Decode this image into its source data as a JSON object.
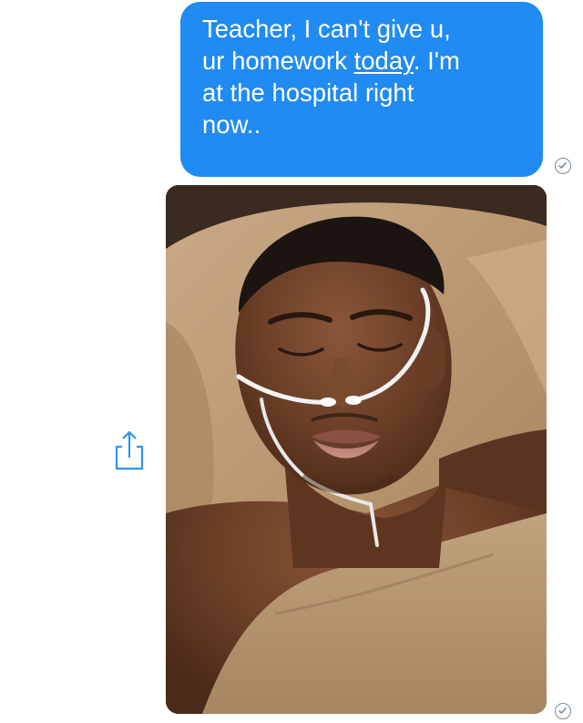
{
  "conversation": {
    "outgoing_message": {
      "lines": [
        {
          "before": "Teacher, I can't give u,",
          "link": "",
          "after": ""
        },
        {
          "before": "ur homework ",
          "link": "today",
          "after": ". I'm"
        },
        {
          "before": "at the hospital right",
          "link": "",
          "after": ""
        },
        {
          "before": "now..",
          "link": "",
          "after": ""
        }
      ],
      "bubble_color": "#1f8bf3",
      "text_color": "#ffffff"
    },
    "photo_attachment": {
      "subject": "person-sleeping-with-nasal-cannula"
    },
    "receipt_icon": "check-circle-icon",
    "share_icon": "share-icon"
  }
}
